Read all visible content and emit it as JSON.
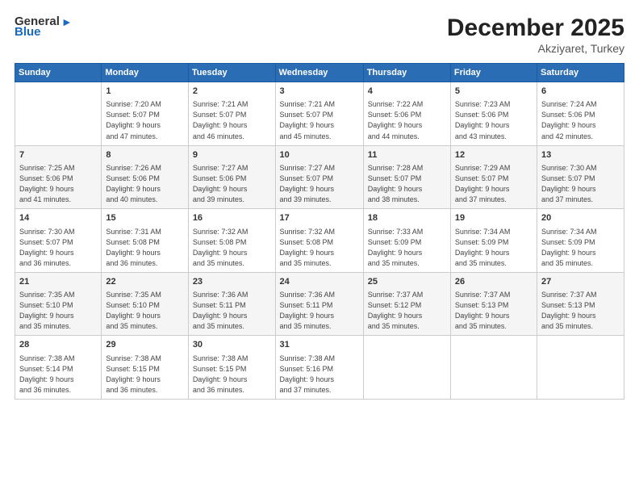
{
  "logo": {
    "text_general": "General",
    "text_blue": "Blue",
    "icon": "▶"
  },
  "title": {
    "month_year": "December 2025",
    "location": "Akziyaret, Turkey"
  },
  "days_of_week": [
    "Sunday",
    "Monday",
    "Tuesday",
    "Wednesday",
    "Thursday",
    "Friday",
    "Saturday"
  ],
  "weeks": [
    [
      {
        "day": "",
        "info": ""
      },
      {
        "day": "1",
        "info": "Sunrise: 7:20 AM\nSunset: 5:07 PM\nDaylight: 9 hours\nand 47 minutes."
      },
      {
        "day": "2",
        "info": "Sunrise: 7:21 AM\nSunset: 5:07 PM\nDaylight: 9 hours\nand 46 minutes."
      },
      {
        "day": "3",
        "info": "Sunrise: 7:21 AM\nSunset: 5:07 PM\nDaylight: 9 hours\nand 45 minutes."
      },
      {
        "day": "4",
        "info": "Sunrise: 7:22 AM\nSunset: 5:06 PM\nDaylight: 9 hours\nand 44 minutes."
      },
      {
        "day": "5",
        "info": "Sunrise: 7:23 AM\nSunset: 5:06 PM\nDaylight: 9 hours\nand 43 minutes."
      },
      {
        "day": "6",
        "info": "Sunrise: 7:24 AM\nSunset: 5:06 PM\nDaylight: 9 hours\nand 42 minutes."
      }
    ],
    [
      {
        "day": "7",
        "info": "Sunrise: 7:25 AM\nSunset: 5:06 PM\nDaylight: 9 hours\nand 41 minutes."
      },
      {
        "day": "8",
        "info": "Sunrise: 7:26 AM\nSunset: 5:06 PM\nDaylight: 9 hours\nand 40 minutes."
      },
      {
        "day": "9",
        "info": "Sunrise: 7:27 AM\nSunset: 5:06 PM\nDaylight: 9 hours\nand 39 minutes."
      },
      {
        "day": "10",
        "info": "Sunrise: 7:27 AM\nSunset: 5:07 PM\nDaylight: 9 hours\nand 39 minutes."
      },
      {
        "day": "11",
        "info": "Sunrise: 7:28 AM\nSunset: 5:07 PM\nDaylight: 9 hours\nand 38 minutes."
      },
      {
        "day": "12",
        "info": "Sunrise: 7:29 AM\nSunset: 5:07 PM\nDaylight: 9 hours\nand 37 minutes."
      },
      {
        "day": "13",
        "info": "Sunrise: 7:30 AM\nSunset: 5:07 PM\nDaylight: 9 hours\nand 37 minutes."
      }
    ],
    [
      {
        "day": "14",
        "info": "Sunrise: 7:30 AM\nSunset: 5:07 PM\nDaylight: 9 hours\nand 36 minutes."
      },
      {
        "day": "15",
        "info": "Sunrise: 7:31 AM\nSunset: 5:08 PM\nDaylight: 9 hours\nand 36 minutes."
      },
      {
        "day": "16",
        "info": "Sunrise: 7:32 AM\nSunset: 5:08 PM\nDaylight: 9 hours\nand 35 minutes."
      },
      {
        "day": "17",
        "info": "Sunrise: 7:32 AM\nSunset: 5:08 PM\nDaylight: 9 hours\nand 35 minutes."
      },
      {
        "day": "18",
        "info": "Sunrise: 7:33 AM\nSunset: 5:09 PM\nDaylight: 9 hours\nand 35 minutes."
      },
      {
        "day": "19",
        "info": "Sunrise: 7:34 AM\nSunset: 5:09 PM\nDaylight: 9 hours\nand 35 minutes."
      },
      {
        "day": "20",
        "info": "Sunrise: 7:34 AM\nSunset: 5:09 PM\nDaylight: 9 hours\nand 35 minutes."
      }
    ],
    [
      {
        "day": "21",
        "info": "Sunrise: 7:35 AM\nSunset: 5:10 PM\nDaylight: 9 hours\nand 35 minutes."
      },
      {
        "day": "22",
        "info": "Sunrise: 7:35 AM\nSunset: 5:10 PM\nDaylight: 9 hours\nand 35 minutes."
      },
      {
        "day": "23",
        "info": "Sunrise: 7:36 AM\nSunset: 5:11 PM\nDaylight: 9 hours\nand 35 minutes."
      },
      {
        "day": "24",
        "info": "Sunrise: 7:36 AM\nSunset: 5:11 PM\nDaylight: 9 hours\nand 35 minutes."
      },
      {
        "day": "25",
        "info": "Sunrise: 7:37 AM\nSunset: 5:12 PM\nDaylight: 9 hours\nand 35 minutes."
      },
      {
        "day": "26",
        "info": "Sunrise: 7:37 AM\nSunset: 5:13 PM\nDaylight: 9 hours\nand 35 minutes."
      },
      {
        "day": "27",
        "info": "Sunrise: 7:37 AM\nSunset: 5:13 PM\nDaylight: 9 hours\nand 35 minutes."
      }
    ],
    [
      {
        "day": "28",
        "info": "Sunrise: 7:38 AM\nSunset: 5:14 PM\nDaylight: 9 hours\nand 36 minutes."
      },
      {
        "day": "29",
        "info": "Sunrise: 7:38 AM\nSunset: 5:15 PM\nDaylight: 9 hours\nand 36 minutes."
      },
      {
        "day": "30",
        "info": "Sunrise: 7:38 AM\nSunset: 5:15 PM\nDaylight: 9 hours\nand 36 minutes."
      },
      {
        "day": "31",
        "info": "Sunrise: 7:38 AM\nSunset: 5:16 PM\nDaylight: 9 hours\nand 37 minutes."
      },
      {
        "day": "",
        "info": ""
      },
      {
        "day": "",
        "info": ""
      },
      {
        "day": "",
        "info": ""
      }
    ]
  ]
}
